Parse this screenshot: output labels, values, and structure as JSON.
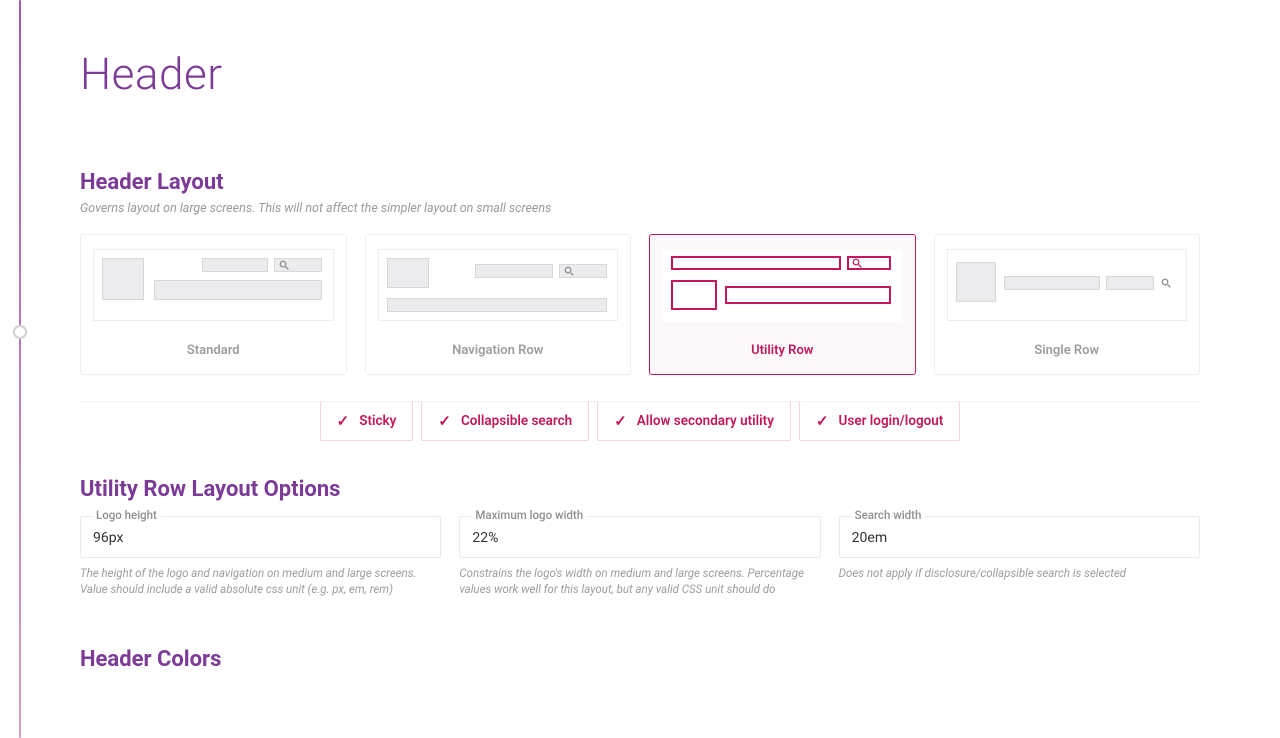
{
  "page_title": "Header",
  "layout": {
    "title": "Header Layout",
    "description": "Governs layout on large screens. This will not affect the simpler layout on small screens",
    "options": [
      {
        "label": "Standard"
      },
      {
        "label": "Navigation Row"
      },
      {
        "label": "Utility Row"
      },
      {
        "label": "Single Row"
      }
    ],
    "selected_index": 2
  },
  "toggles": [
    {
      "label": "Sticky",
      "checked": true
    },
    {
      "label": "Collapsible search",
      "checked": true
    },
    {
      "label": "Allow secondary utility",
      "checked": true
    },
    {
      "label": "User login/logout",
      "checked": true
    }
  ],
  "utility_options": {
    "title": "Utility Row Layout Options",
    "fields": {
      "logo_height": {
        "label": "Logo height",
        "value": "96px",
        "help": "The height of the logo and navigation on medium and large screens. Value should include a valid absolute css unit (e.g. px, em, rem)"
      },
      "max_logo_width": {
        "label": "Maximum logo width",
        "value": "22%",
        "help": "Constrains the logo's width on medium and large screens. Percentage values work well for this layout, but any valid CSS unit should do"
      },
      "search_width": {
        "label": "Search width",
        "value": "20em",
        "help": "Does not apply if disclosure/collapsible search is selected"
      }
    }
  },
  "colors_title": "Header Colors",
  "accent": "#c2185b",
  "heading_color": "#7b3b97",
  "icons": {
    "check": "check-icon",
    "search": "search-icon"
  }
}
